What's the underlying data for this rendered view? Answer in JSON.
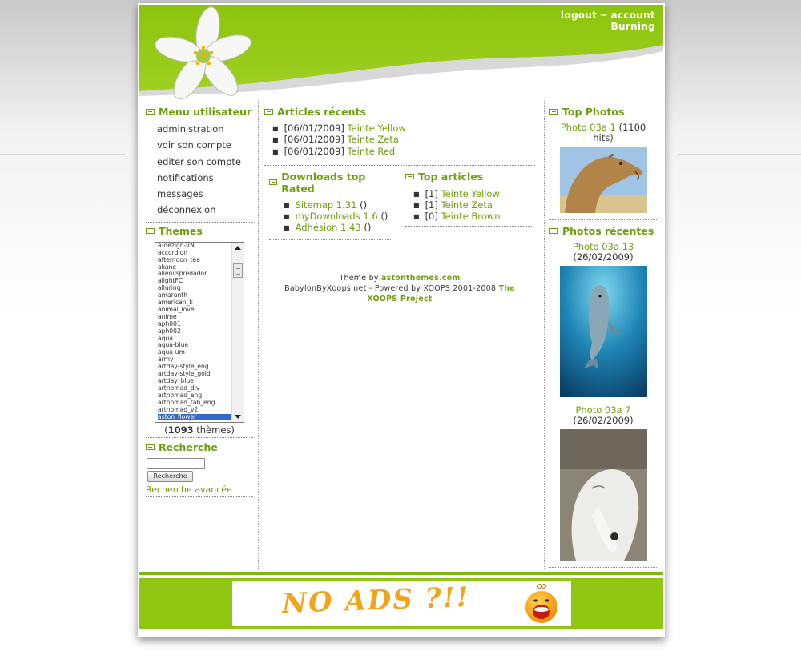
{
  "header": {
    "logout_label": "logout",
    "separator": "~",
    "account_label": "account",
    "site_name": "Burning",
    "accent_color": "#8fc710"
  },
  "user_menu": {
    "title": "Menu utilisateur",
    "items": [
      "administration",
      "voir son compte",
      "editer son compte",
      "notifications",
      "messages",
      "déconnexion"
    ]
  },
  "themes": {
    "title": "Themes",
    "list": [
      "a-dezign-VN",
      "accordion",
      "afternoon_tea",
      "akane",
      "alienvspredador",
      "alightFC",
      "alluring",
      "amaranth",
      "american_k",
      "animal_love",
      "anime",
      "aph001",
      "aph002",
      "aqua",
      "aqua-blue",
      "aqua-um",
      "army",
      "artday-style_eng",
      "artday-style_gold",
      "artday_blue",
      "artnomad_div",
      "artnomad_eng",
      "artnomad_tab_eng",
      "artnomad_v2",
      "aston_flower"
    ],
    "selected": "aston_flower",
    "count": "1093",
    "count_suffix": "thèmes"
  },
  "search": {
    "title": "Recherche",
    "input_value": "",
    "button_label": "Recherche",
    "advanced_label": "Recherche avancée"
  },
  "recent_articles": {
    "title": "Articles récents",
    "items": [
      {
        "date": "[06/01/2009]",
        "title": "Teinte Yellow"
      },
      {
        "date": "[06/01/2009]",
        "title": "Teinte Zeta"
      },
      {
        "date": "[06/01/2009]",
        "title": "Teinte Red"
      }
    ]
  },
  "downloads": {
    "title": "Downloads top Rated",
    "items": [
      {
        "name": "Sitemap 1.31",
        "count": "()"
      },
      {
        "name": "myDownloads 1.6",
        "count": "()"
      },
      {
        "name": "Adhésion 1.43",
        "count": "()"
      }
    ]
  },
  "top_articles": {
    "title": "Top articles",
    "items": [
      {
        "rank": "[1]",
        "title": "Teinte Yellow"
      },
      {
        "rank": "[1]",
        "title": "Teinte Zeta"
      },
      {
        "rank": "[0]",
        "title": "Teinte Brown"
      }
    ]
  },
  "credits": {
    "theme_by_prefix": "Theme by",
    "theme_by_link": "astonthemes.com",
    "powered_prefix": "BabylonByXoops.net - Powered by XOOPS 2001-2008",
    "powered_link": "The XOOPS Project"
  },
  "top_photos": {
    "title": "Top Photos",
    "caption_link": "Photo 03a 1",
    "caption_rest": "(1100 hits)",
    "image": "camel-photo"
  },
  "recent_photos": {
    "title": "Photos récentes",
    "items": [
      {
        "link": "Photo 03a 13",
        "date": "(26/02/2009)",
        "image": "dolphin-photo"
      },
      {
        "link": "Photo 03a 7",
        "date": "(26/02/2009)",
        "image": "polar-bear-photo"
      }
    ]
  },
  "footer": {
    "ad_text": "NO ADS ?!!",
    "ad_icon": "screaming-face-icon"
  }
}
